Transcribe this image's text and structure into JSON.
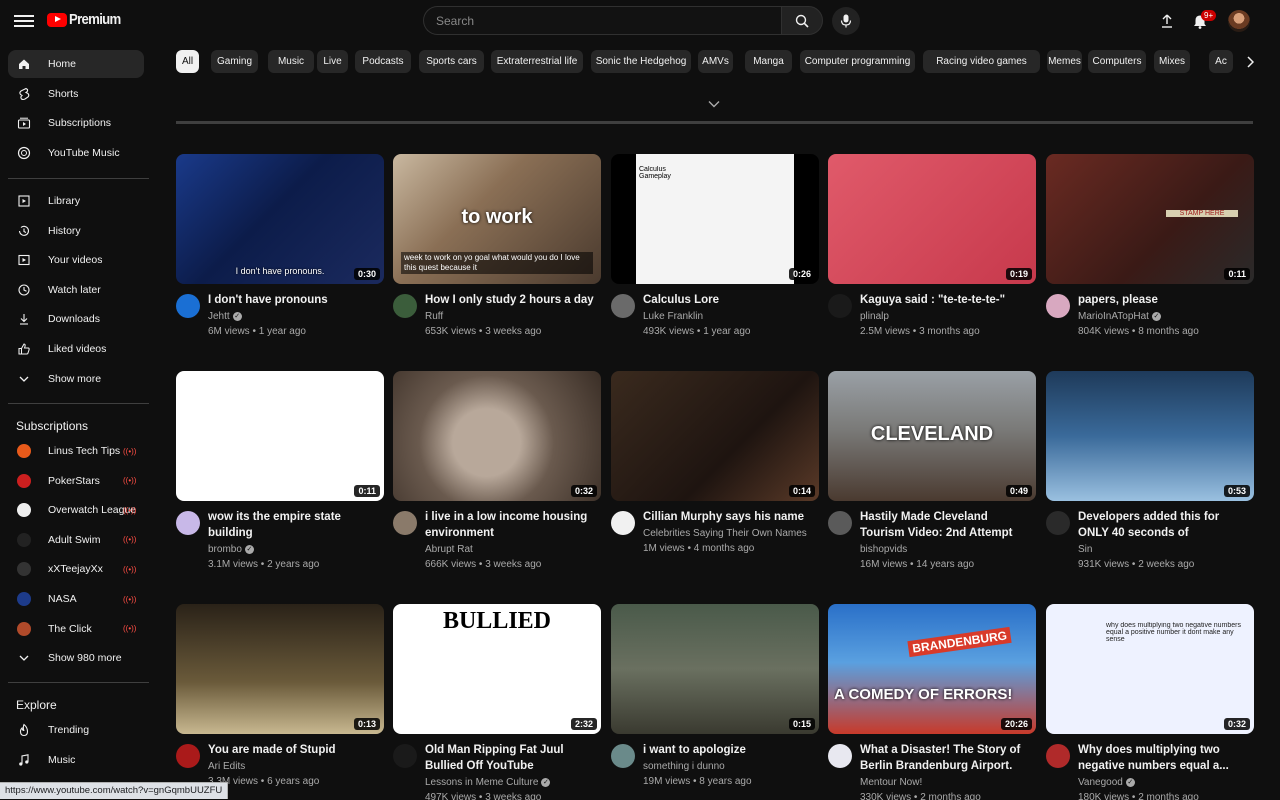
{
  "header": {
    "logo_text": "Premium",
    "search_placeholder": "Search",
    "notifications_badge": "9+"
  },
  "sidebar": {
    "main_items": [
      {
        "label": "Home",
        "icon": "home-icon",
        "active": true
      },
      {
        "label": "Shorts",
        "icon": "shorts-icon"
      },
      {
        "label": "Subscriptions",
        "icon": "subscriptions-icon"
      },
      {
        "label": "YouTube Music",
        "icon": "youtube-music-icon"
      }
    ],
    "library_items": [
      {
        "label": "Library",
        "icon": "library-icon"
      },
      {
        "label": "History",
        "icon": "history-icon"
      },
      {
        "label": "Your videos",
        "icon": "your-videos-icon"
      },
      {
        "label": "Watch later",
        "icon": "watch-later-icon"
      },
      {
        "label": "Downloads",
        "icon": "download-icon"
      },
      {
        "label": "Liked videos",
        "icon": "thumbs-up-icon"
      },
      {
        "label": "Show more",
        "icon": "chevron-down-icon"
      }
    ],
    "subscriptions_title": "Subscriptions",
    "subscriptions": [
      {
        "label": "Linus Tech Tips",
        "color": "#e85a1a",
        "live": true
      },
      {
        "label": "PokerStars",
        "color": "#cc1f1f",
        "live": true
      },
      {
        "label": "Overwatch League",
        "color": "#eeeeee",
        "live": true
      },
      {
        "label": "Adult Swim",
        "color": "#222222",
        "live": true
      },
      {
        "label": "xXTeejayXx",
        "color": "#333333",
        "live": true
      },
      {
        "label": "NASA",
        "color": "#1d3b8a",
        "live": true
      },
      {
        "label": "The Click",
        "color": "#b04a2a",
        "live": true
      }
    ],
    "show_more_subs": "Show 980 more",
    "explore_title": "Explore",
    "explore_items": [
      {
        "label": "Trending",
        "icon": "trending-icon"
      },
      {
        "label": "Music",
        "icon": "music-icon"
      }
    ]
  },
  "chips": [
    "All",
    "Gaming",
    "Music",
    "Live",
    "Podcasts",
    "Sports cars",
    "Extraterrestrial life",
    "Sonic the Hedgehog",
    "AMVs",
    "Manga",
    "Computer programming",
    "Racing video games",
    "Memes",
    "Computers",
    "Mixes",
    "Ac"
  ],
  "videos": [
    {
      "title": "I don't have pronouns",
      "channel": "Jehtt",
      "verified": true,
      "stats": "6M views • 1 year ago",
      "duration": "0:30",
      "thumb_caption": "I don't have pronouns.",
      "bg": "linear-gradient(135deg,#1a3a8a 0%,#0c1c4a 45%,#1b2a5e 100%)",
      "avatar": "#1a6fd4"
    },
    {
      "title": "How I only study 2 hours a day",
      "channel": "Ruff",
      "verified": false,
      "stats": "653K views • 3 weeks ago",
      "duration": "",
      "thumb_caption": "to work",
      "thumb_subtitle": "week to work on yo  goal what would you do I love this quest   because it",
      "bg": "linear-gradient(135deg,#c9b8a0 0%,#8a6f55 40%,#4a3a2e 100%)",
      "avatar": "#3b5d3b"
    },
    {
      "title": "Calculus Lore",
      "channel": "Luke Franklin",
      "verified": false,
      "stats": "493K views • 1 year ago",
      "duration": "0:26",
      "thumb_caption": "Calculus Gameplay",
      "bg": "linear-gradient(90deg,#000 0 12%,#f4f4f4 12% 88%,#000 88%)",
      "avatar": "#6a6a6a"
    },
    {
      "title": "Kaguya said : \"te-te-te-te-\"",
      "channel": "plinalp",
      "verified": false,
      "stats": "2.5M views • 3 months ago",
      "duration": "0:19",
      "bg": "linear-gradient(135deg,#e05a6a 0%,#c7394c 100%)",
      "avatar": "#1a1a1a"
    },
    {
      "title": "papers, please",
      "channel": "MarioInATopHat",
      "verified": true,
      "stats": "804K views • 8 months ago",
      "duration": "0:11",
      "thumb_caption": "STAMP HERE",
      "bg": "linear-gradient(135deg,#6a2a22 0%,#3a1a16 60%,#2a2a2a 100%)",
      "avatar": "#d8a8c0"
    },
    {
      "title": "wow its the empire state building",
      "channel": "brombo",
      "verified": true,
      "stats": "3.1M views • 2 years ago",
      "duration": "0:11",
      "bg": "#ffffff",
      "avatar": "#c8b8e8"
    },
    {
      "title": "i live in a low income housing environment",
      "channel": "Abrupt Rat",
      "verified": false,
      "stats": "666K views • 3 weeks ago",
      "duration": "0:32",
      "bg": "radial-gradient(circle at 45% 55%,#b8a89a 0 25%,#6a5a4e 50%,#3a2e26 100%)",
      "avatar": "#8a7a6a"
    },
    {
      "title": "Cillian Murphy says his name",
      "channel": "Celebrities Saying Their Own Names",
      "verified": false,
      "stats": "1M views • 4 months ago",
      "duration": "0:14",
      "bg": "linear-gradient(135deg,#3a2a1e 0%,#1e1410 60%,#5a3a28 100%)",
      "avatar": "#f1f1f1"
    },
    {
      "title": "Hastily Made Cleveland Tourism Video: 2nd Attempt",
      "channel": "bishopvids",
      "verified": false,
      "stats": "16M views • 14 years ago",
      "duration": "0:49",
      "thumb_caption": "CLEVELAND",
      "bg": "linear-gradient(180deg,#9aa0a6 0%,#7a7a78 45%,#4a3a30 100%)",
      "avatar": "#5a5a5a"
    },
    {
      "title": "Developers added this for ONLY 40 seconds of gameplay...",
      "channel": "Sin",
      "verified": false,
      "stats": "931K views • 2 weeks ago",
      "duration": "0:53",
      "bg": "linear-gradient(180deg,#1e3a5a 0%,#3a6a9a 50%,#9ac0e0 100%)",
      "avatar": "#2a2a2a"
    },
    {
      "title": "You are made of Stupid",
      "channel": "Ari Edits",
      "verified": false,
      "stats": "3.3M views • 6 years ago",
      "duration": "0:13",
      "bg": "linear-gradient(180deg,#2a2218 0%,#6a5a3a 60%,#c8b890 100%)",
      "avatar": "#aa1a1a"
    },
    {
      "title": "Old Man Ripping Fat Juul Bullied Off YouTube",
      "channel": "Lessons in Meme Culture",
      "verified": true,
      "stats": "497K views • 3 weeks ago",
      "duration": "2:32",
      "thumb_caption": "BULLIED",
      "bg": "#ffffff",
      "avatar": "#1a1a1a"
    },
    {
      "title": "i want to apologize",
      "channel": "something i dunno",
      "verified": false,
      "stats": "19M views • 8 years ago",
      "duration": "0:15",
      "bg": "linear-gradient(180deg,#4a5a4a 0%,#6a7060 50%,#3a3a30 100%)",
      "avatar": "#6a8a8a"
    },
    {
      "title": "What a Disaster! The Story of Berlin Brandenburg Airport.",
      "channel": "Mentour Now!",
      "verified": false,
      "stats": "330K views • 2 months ago",
      "duration": "20:26",
      "thumb_caption": "A COMEDY OF ERRORS!",
      "thumb_subtitle": "BRANDENBURG",
      "bg": "linear-gradient(180deg,#2a70c8 0%,#5aa0e0 45%,#c83a2a 100%)",
      "avatar": "#e8e8f0"
    },
    {
      "title": "Why does multiplying two negative numbers equal a...",
      "channel": "Vanegood",
      "verified": true,
      "stats": "180K views • 2 months ago",
      "duration": "0:32",
      "thumb_caption": "why does multiplying two negative numbers equal a positive number it dont make any sense",
      "bg": "#eef2ff",
      "avatar": "#b02a2a"
    }
  ],
  "status_url": "https://www.youtube.com/watch?v=gnGqmbUUZFU"
}
